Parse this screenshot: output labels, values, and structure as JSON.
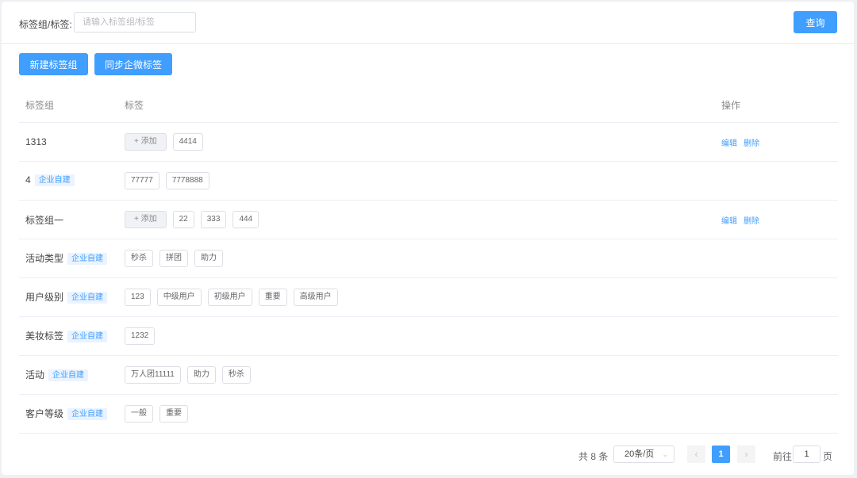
{
  "search": {
    "label": "标签组/标签:",
    "placeholder": "请输入标签组/标签",
    "query_button": "查询"
  },
  "actions": {
    "new_group": "新建标签组",
    "sync": "同步企微标签"
  },
  "table": {
    "headers": [
      "标签组",
      "标签",
      "操作"
    ],
    "add_label": "+ 添加",
    "edit_label": "编辑",
    "delete_label": "删除",
    "rows": [
      {
        "name": "1313",
        "badge": "",
        "add": true,
        "tags": [
          "4414"
        ],
        "ops": true
      },
      {
        "name": "4",
        "badge": "企业自建",
        "add": false,
        "tags": [
          "77777",
          "7778888"
        ],
        "ops": false
      },
      {
        "name": "标签组一",
        "badge": "",
        "add": true,
        "tags": [
          "22",
          "333",
          "444"
        ],
        "ops": true
      },
      {
        "name": "活动类型",
        "badge": "企业自建",
        "add": false,
        "tags": [
          "秒杀",
          "拼团",
          "助力"
        ],
        "ops": false
      },
      {
        "name": "用户级别",
        "badge": "企业自建",
        "add": false,
        "tags": [
          "123",
          "中级用户",
          "初级用户",
          "重要",
          "高级用户"
        ],
        "ops": false
      },
      {
        "name": "美妆标签",
        "badge": "企业自建",
        "add": false,
        "tags": [
          "1232"
        ],
        "ops": false
      },
      {
        "name": "活动",
        "badge": "企业自建",
        "add": false,
        "tags": [
          "万人团11111",
          "助力",
          "秒杀"
        ],
        "ops": false
      },
      {
        "name": "客户等级",
        "badge": "企业自建",
        "add": false,
        "tags": [
          "一般",
          "重要"
        ],
        "ops": false
      }
    ]
  },
  "pagination": {
    "total": "共 8 条",
    "page_size": "20条/页",
    "current_page": "1",
    "goto_label": "前往",
    "goto_value": "1",
    "page_unit": "页"
  },
  "colors": {
    "primary": "#409eff",
    "badge_bg": "#eaf3ff"
  },
  "icons": {
    "page_size_chevron": "chevron-down-icon",
    "prev": "chevron-left-icon",
    "next": "chevron-right-icon"
  }
}
